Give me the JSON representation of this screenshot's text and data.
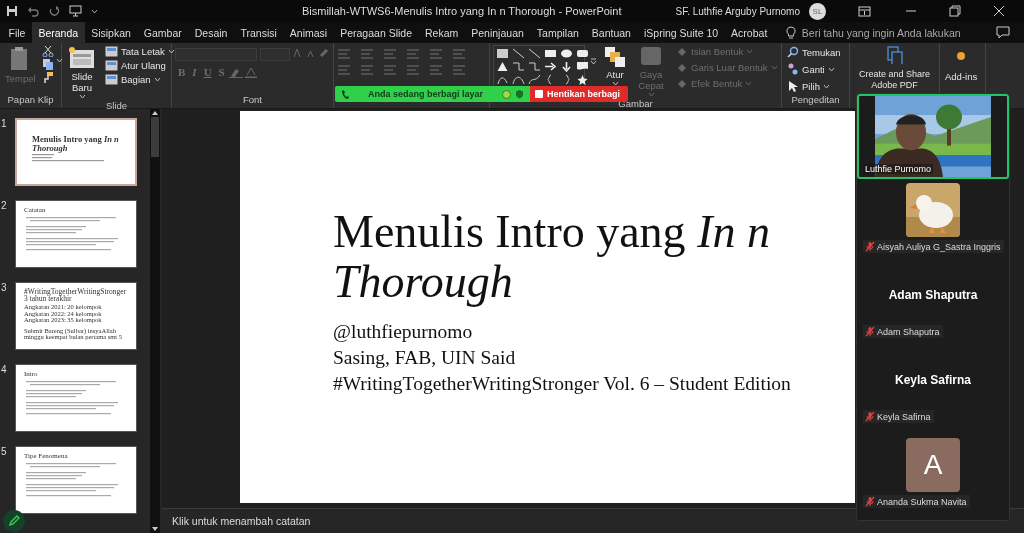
{
  "window": {
    "title": "Bismillah-WTWS6-Menulis Intro yang In n Thorough  -  PowerPoint",
    "user": "SF. Luthfie Arguby Purnomo",
    "avatar_initials": "SL"
  },
  "tabs": [
    {
      "label": "File",
      "selected": false
    },
    {
      "label": "Beranda",
      "selected": true
    },
    {
      "label": "Sisipkan",
      "selected": false
    },
    {
      "label": "Gambar",
      "selected": false
    },
    {
      "label": "Desain",
      "selected": false
    },
    {
      "label": "Transisi",
      "selected": false
    },
    {
      "label": "Animasi",
      "selected": false
    },
    {
      "label": "Peragaan Slide",
      "selected": false
    },
    {
      "label": "Rekam",
      "selected": false
    },
    {
      "label": "Peninjauan",
      "selected": false
    },
    {
      "label": "Tampilan",
      "selected": false
    },
    {
      "label": "Bantuan",
      "selected": false
    },
    {
      "label": "iSpring Suite 10",
      "selected": false
    },
    {
      "label": "Acrobat",
      "selected": false
    }
  ],
  "tell_me": {
    "placeholder": "Beri tahu yang ingin Anda lakukan"
  },
  "ribbon": {
    "groups": [
      {
        "kind": "clipboard",
        "label": "Papan Klip",
        "items": [
          {
            "label": "Tempel",
            "disabled": true
          }
        ]
      },
      {
        "kind": "slides",
        "label": "Slide",
        "items": [
          {
            "label": "Slide Baru",
            "disabled": false,
            "dropdown": true
          },
          {
            "label": "Tata Letak",
            "disabled": false,
            "dropdown": true
          },
          {
            "label": "Atur Ulang",
            "disabled": false,
            "dropdown": false
          },
          {
            "label": "Bagian",
            "disabled": false,
            "dropdown": true
          }
        ]
      },
      {
        "kind": "font",
        "label": "Font",
        "items": [
          {
            "label": "B",
            "disabled": true
          },
          {
            "label": "I",
            "disabled": true
          },
          {
            "label": "U",
            "disabled": true
          },
          {
            "label": "S",
            "disabled": true
          }
        ]
      },
      {
        "kind": "paragraph"
      },
      {
        "kind": "drawing",
        "label": "Gambar",
        "items": [
          {
            "label": "Atur",
            "disabled": false,
            "dropdown": true
          },
          {
            "label": "Gaya Cepat",
            "disabled": true,
            "dropdown": true
          },
          {
            "label": "Isian Bentuk",
            "disabled": true,
            "dropdown": true
          },
          {
            "label": "Garis Luar Bentuk",
            "disabled": true,
            "dropdown": true
          },
          {
            "label": "Efek Bentuk",
            "disabled": true,
            "dropdown": true
          }
        ]
      },
      {
        "kind": "editing",
        "label": "Pengeditan",
        "items": [
          {
            "label": "Temukan",
            "disabled": false,
            "dropdown": false
          },
          {
            "label": "Ganti",
            "disabled": false,
            "dropdown": true
          },
          {
            "label": "Pilih",
            "disabled": false,
            "dropdown": true
          }
        ]
      },
      {
        "kind": "adobe",
        "items": [
          {
            "label": "Create and Share Adobe PDF",
            "disabled": false
          }
        ]
      },
      {
        "kind": "addins",
        "items": [
          {
            "label": "Add-ins",
            "disabled": false
          }
        ]
      }
    ]
  },
  "share_banner": {
    "status": "Anda sedang berbagi layar",
    "stop_button": "Hentikan berbagi"
  },
  "slides": [
    {
      "number": "1",
      "selected": true,
      "kind": "title",
      "title": "Menulis Intro yang *In n Thorough*"
    },
    {
      "number": "2",
      "selected": false,
      "kind": "content",
      "title": "Catatan"
    },
    {
      "number": "3",
      "selected": false,
      "kind": "text",
      "title": "#WritingTogetherWritingStronger 3 tahun terakhir",
      "body": [
        "Angkatan 2021: 20 kelompok",
        "Angkatan 2022: 24 kelompok",
        "Angkatan 2023: 35 kelompok",
        "Submit Bareng (Sulbar) insyaAllah minggu keempat bulan pertama smt 5"
      ]
    },
    {
      "number": "4",
      "selected": false,
      "kind": "content",
      "title": "Intro"
    },
    {
      "number": "5",
      "selected": false,
      "kind": "content",
      "title": "Tipe Fenomena"
    }
  ],
  "current_slide": {
    "title": "Menulis Intro yang *In n Thorough*",
    "lines": [
      "@luthfiepurnomo",
      "Sasing, FAB, UIN Said",
      "#WritingTogetherWritingStronger Vol. 6 – Student Edition"
    ]
  },
  "notes": {
    "placeholder": "Klik untuk menambah catatan"
  },
  "meeting": {
    "participants": [
      {
        "name": "Luthfie Purnomo",
        "kind": "video",
        "active_speaker": true,
        "muted": false
      },
      {
        "name": "Aisyah Auliya G_Sastra Inggris",
        "kind": "picture",
        "active_speaker": false,
        "muted": true
      },
      {
        "name": "Adam Shaputra",
        "kind": "name",
        "display_name": "Adam Shaputra",
        "active_speaker": false,
        "muted": true
      },
      {
        "name": "Keyla Safirna",
        "kind": "name",
        "display_name": "Keyla Safirna",
        "active_speaker": false,
        "muted": true
      },
      {
        "name": "Ananda Sukma Navita",
        "kind": "initial",
        "initial": "A",
        "color": "#8a6b60",
        "active_speaker": false,
        "muted": true
      }
    ]
  }
}
